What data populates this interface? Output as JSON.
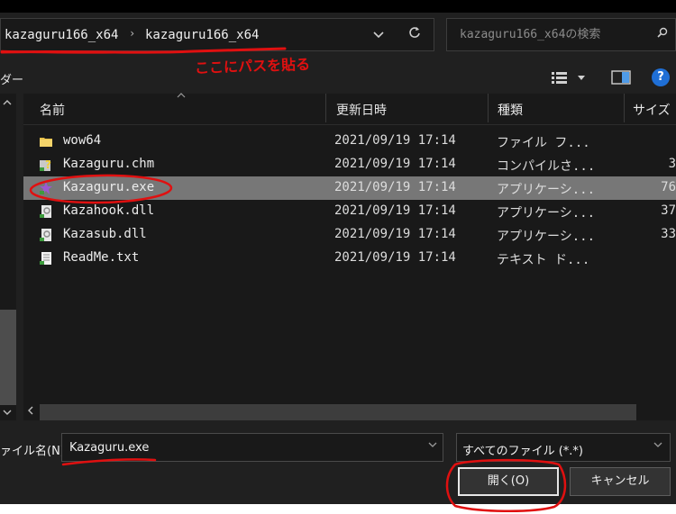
{
  "address_bar": {
    "crumbs": [
      "kazaguru166_x64",
      "kazaguru166_x64"
    ],
    "separator": "›",
    "dropdown_icon": "chevron-down-icon",
    "refresh_icon": "refresh-icon"
  },
  "search": {
    "placeholder": "kazaguru166_x64の検索",
    "icon": "search-icon"
  },
  "toolbar": {
    "left_label": "ダー",
    "view_icon": "details-view-icon",
    "preview_icon": "preview-pane-icon",
    "help_label": "?"
  },
  "columns": {
    "name": "名前",
    "date": "更新日時",
    "type": "種類",
    "size": "サイズ"
  },
  "files": [
    {
      "name": "wow64",
      "date": "2021/09/19 17:14",
      "type": "ファイル フ...",
      "size": "",
      "icon": "folder-icon",
      "selected": false
    },
    {
      "name": "Kazaguru.chm",
      "date": "2021/09/19 17:14",
      "type": "コンパイルさ...",
      "size": "3",
      "icon": "help-file-icon",
      "selected": false
    },
    {
      "name": "Kazaguru.exe",
      "date": "2021/09/19 17:14",
      "type": "アプリケーシ...",
      "size": "76",
      "icon": "application-icon",
      "selected": true
    },
    {
      "name": "Kazahook.dll",
      "date": "2021/09/19 17:14",
      "type": "アプリケーシ...",
      "size": "37",
      "icon": "dll-file-icon",
      "selected": false
    },
    {
      "name": "Kazasub.dll",
      "date": "2021/09/19 17:14",
      "type": "アプリケーシ...",
      "size": "33",
      "icon": "dll-file-icon",
      "selected": false
    },
    {
      "name": "ReadMe.txt",
      "date": "2021/09/19 17:14",
      "type": "テキスト ド...",
      "size": "",
      "icon": "text-file-icon",
      "selected": false
    }
  ],
  "filename": {
    "label": "ァイル名(N):",
    "value": "Kazaguru.exe"
  },
  "filetype": {
    "value": "すべてのファイル (*.*)"
  },
  "buttons": {
    "open": "開く(O)",
    "cancel": "キャンセル"
  },
  "annotation": {
    "text": "ここにパスを貼る",
    "color": "#e01010"
  },
  "colors": {
    "background": "#202020",
    "selected_row": "#777777",
    "annotation": "#e01010"
  }
}
